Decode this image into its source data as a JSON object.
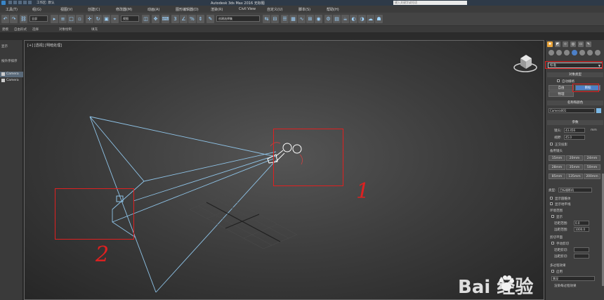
{
  "window": {
    "title": "Autodesk 3ds Max 2016   无标题",
    "workspace": "工作区: 默认",
    "search_placeholder": "键入关键字或短语"
  },
  "menu": [
    "工具(T)",
    "组(G)",
    "视图(V)",
    "创建(C)",
    "修改器(M)",
    "动画(A)",
    "图形编辑器(D)",
    "渲染(R)",
    "Civil View",
    "自定义(U)",
    "脚本(S)",
    "帮助(H)"
  ],
  "toolbar": {
    "selection_filter": "全部",
    "view_coord": "视图",
    "named_sel": "创建选择集"
  },
  "ribbon": [
    "建模",
    "自由形式",
    "选择",
    "对象绘制",
    "填充"
  ],
  "scene_explorer": {
    "label_display": "显示",
    "label_sort": "按升序排序",
    "items": [
      "Camera",
      "Camera"
    ]
  },
  "viewport": {
    "label": "[+] [透视] [明暗处理]"
  },
  "command_panel": {
    "category_dropdown": "标准",
    "section_object_type": "对象类型",
    "autogrid_label": "自动栅格",
    "buttons": {
      "free": "自由",
      "target": "目标",
      "physical": "物理"
    },
    "section_name_color": "名称和颜色",
    "object_name": "Camera001",
    "section_params": "参数",
    "lens_label": "镜头:",
    "lens_value": "43.456",
    "lens_unit": "mm",
    "fov_label": "视野:",
    "fov_value": "45.0",
    "ortho_label": "正交投影",
    "stock_lenses_label": "备用镜头",
    "stock_lenses": [
      "15mm",
      "20mm",
      "24mm",
      "28mm",
      "35mm",
      "50mm",
      "85mm",
      "135mm",
      "200mm"
    ],
    "type_label": "类型:",
    "type_value": "目标摄影机",
    "show_cone": "显示圆锥体",
    "show_horizon": "显示地平线",
    "env_range": "环境范围",
    "env_show": "显示",
    "near_range": "近距范围:",
    "near_value": "0.0",
    "far_range": "远距范围:",
    "far_value": "1000.0",
    "clip_plane": "剪切平面",
    "manual_clip": "手动剪切",
    "near_clip": "近距剪切:",
    "far_clip": "远距剪切:",
    "multipass": "多过程效果",
    "enable": "启用",
    "multipass_type": "景深",
    "render_pass": "渲染每过程效果"
  },
  "annotations": {
    "mark1": "1",
    "mark2": "2"
  },
  "watermark": "Bai  经验"
}
